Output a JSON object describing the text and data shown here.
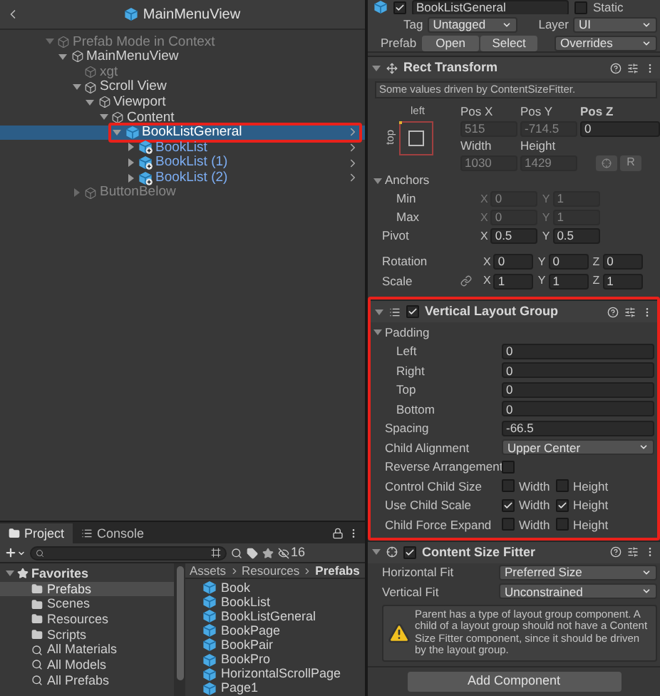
{
  "hierarchy": {
    "title": "MainMenuView",
    "tree": [
      {
        "label": "Prefab Mode in Context",
        "kind": "context",
        "expanded": true,
        "dimmed": true,
        "selected": false,
        "highlighted": false,
        "children": [
          {
            "label": "MainMenuView",
            "kind": "object",
            "expanded": true,
            "dimmed": false,
            "selected": false,
            "highlighted": false,
            "children": [
              {
                "label": "xgt",
                "kind": "object",
                "dimmed": true,
                "selected": false,
                "highlighted": false
              },
              {
                "label": "Scroll View",
                "kind": "object",
                "expanded": true,
                "dimmed": false,
                "selected": false,
                "highlighted": false,
                "children": [
                  {
                    "label": "Viewport",
                    "kind": "object",
                    "expanded": true,
                    "dimmed": false,
                    "selected": false,
                    "highlighted": false,
                    "children": [
                      {
                        "label": "Content",
                        "kind": "object",
                        "expanded": true,
                        "dimmed": false,
                        "selected": false,
                        "highlighted": false,
                        "children": [
                          {
                            "label": "BookListGeneral",
                            "kind": "prefab",
                            "expanded": true,
                            "dimmed": false,
                            "selected": true,
                            "highlighted": true,
                            "children": [
                              {
                                "label": "BookList",
                                "kind": "nested_prefab",
                                "expanded": false,
                                "dimmed": false,
                                "selected": false,
                                "highlighted": false
                              },
                              {
                                "label": "BookList (1)",
                                "kind": "nested_prefab",
                                "expanded": false,
                                "dimmed": false,
                                "selected": false,
                                "highlighted": false
                              },
                              {
                                "label": "BookList (2)",
                                "kind": "nested_prefab",
                                "expanded": false,
                                "dimmed": false,
                                "selected": false,
                                "highlighted": false
                              }
                            ]
                          }
                        ]
                      }
                    ]
                  }
                ]
              },
              {
                "label": "ButtonBelow",
                "kind": "object",
                "expanded": false,
                "dimmed": true,
                "selected": false,
                "highlighted": false
              }
            ]
          }
        ]
      }
    ]
  },
  "project": {
    "tabs": [
      {
        "label": "Project",
        "selected": true
      },
      {
        "label": "Console",
        "selected": false
      }
    ],
    "hidden_count": "16",
    "favorites": {
      "label": "Favorites",
      "expanded": true,
      "items": [
        {
          "label": "Prefabs",
          "kind": "folder",
          "selected": true
        },
        {
          "label": "Scenes",
          "kind": "folder",
          "selected": false
        },
        {
          "label": "Resources",
          "kind": "folder",
          "selected": false
        },
        {
          "label": "Scripts",
          "kind": "folder",
          "selected": false
        },
        {
          "label": "All Materials",
          "kind": "search",
          "selected": false
        },
        {
          "label": "All Models",
          "kind": "search",
          "selected": false
        },
        {
          "label": "All Prefabs",
          "kind": "search",
          "selected": false
        }
      ]
    },
    "breadcrumb": [
      "Assets",
      "Resources",
      "Prefabs"
    ],
    "files": [
      "Book",
      "BookList",
      "BookListGeneral",
      "BookPage",
      "BookPair",
      "BookPro",
      "HorizontalScrollPage",
      "Page1"
    ]
  },
  "inspector": {
    "object": {
      "name": "BookListGeneral",
      "active": true,
      "static_label": "Static",
      "static": false
    },
    "tag": {
      "label": "Tag",
      "value": "Untagged"
    },
    "layer": {
      "label": "Layer",
      "value": "UI"
    },
    "prefab": {
      "label": "Prefab",
      "buttons": [
        "Open",
        "Select"
      ],
      "overrides": "Overrides"
    },
    "rect_transform": {
      "title": "Rect Transform",
      "expanded": true,
      "info": "Some values driven by ContentSizeFitter.",
      "anchor_preset": {
        "horizontal": "left",
        "vertical": "top"
      },
      "position": [
        {
          "label": "Pos X",
          "value": "515",
          "driven": true
        },
        {
          "label": "Pos Y",
          "value": "-714.5",
          "driven": true
        },
        {
          "label": "Pos Z",
          "value": "0",
          "driven": false
        }
      ],
      "size": [
        {
          "label": "Width",
          "value": "1030",
          "driven": true
        },
        {
          "label": "Height",
          "value": "1429",
          "driven": true
        }
      ],
      "raw_button": "R",
      "anchors": {
        "label": "Anchors",
        "expanded": true,
        "rows": [
          {
            "label": "Min",
            "driven": true,
            "fields": [
              {
                "axis": "X",
                "value": "0"
              },
              {
                "axis": "Y",
                "value": "1"
              }
            ]
          },
          {
            "label": "Max",
            "driven": true,
            "fields": [
              {
                "axis": "X",
                "value": "0"
              },
              {
                "axis": "Y",
                "value": "1"
              }
            ]
          }
        ]
      },
      "pivot": {
        "label": "Pivot",
        "fields": [
          {
            "axis": "X",
            "value": "0.5"
          },
          {
            "axis": "Y",
            "value": "0.5"
          }
        ]
      },
      "rotation": {
        "label": "Rotation",
        "fields": [
          {
            "axis": "X",
            "value": "0"
          },
          {
            "axis": "Y",
            "value": "0"
          },
          {
            "axis": "Z",
            "value": "0"
          }
        ]
      },
      "scale": {
        "label": "Scale",
        "fields": [
          {
            "axis": "X",
            "value": "1"
          },
          {
            "axis": "Y",
            "value": "1"
          },
          {
            "axis": "Z",
            "value": "1"
          }
        ]
      }
    },
    "layout_group": {
      "title": "Vertical Layout Group",
      "enabled": true,
      "expanded": true,
      "highlighted": true,
      "padding": {
        "label": "Padding",
        "expanded": true,
        "rows": [
          {
            "label": "Left",
            "value": "0"
          },
          {
            "label": "Right",
            "value": "0"
          },
          {
            "label": "Top",
            "value": "0"
          },
          {
            "label": "Bottom",
            "value": "0"
          }
        ]
      },
      "rows": [
        {
          "kind": "number",
          "label": "Spacing",
          "value": "-66.5"
        },
        {
          "kind": "dropdown",
          "label": "Child Alignment",
          "value": "Upper Center"
        },
        {
          "kind": "toggle",
          "label": "Reverse Arrangement",
          "checked": false
        },
        {
          "kind": "pair",
          "label": "Control Child Size",
          "options": [
            {
              "label": "Width",
              "checked": false
            },
            {
              "label": "Height",
              "checked": false
            }
          ]
        },
        {
          "kind": "pair",
          "label": "Use Child Scale",
          "options": [
            {
              "label": "Width",
              "checked": true
            },
            {
              "label": "Height",
              "checked": true
            }
          ]
        },
        {
          "kind": "pair",
          "label": "Child Force Expand",
          "options": [
            {
              "label": "Width",
              "checked": false
            },
            {
              "label": "Height",
              "checked": false
            }
          ]
        }
      ]
    },
    "size_fitter": {
      "title": "Content Size Fitter",
      "enabled": true,
      "expanded": true,
      "rows": [
        {
          "kind": "dropdown",
          "label": "Horizontal Fit",
          "value": "Preferred Size"
        },
        {
          "kind": "dropdown",
          "label": "Vertical Fit",
          "value": "Unconstrained"
        }
      ],
      "warning": "Parent has a type of layout group component. A child of a layout group should not have a Content Size Fitter component, since it should be driven by the layout group."
    },
    "add_component": "Add Component"
  }
}
